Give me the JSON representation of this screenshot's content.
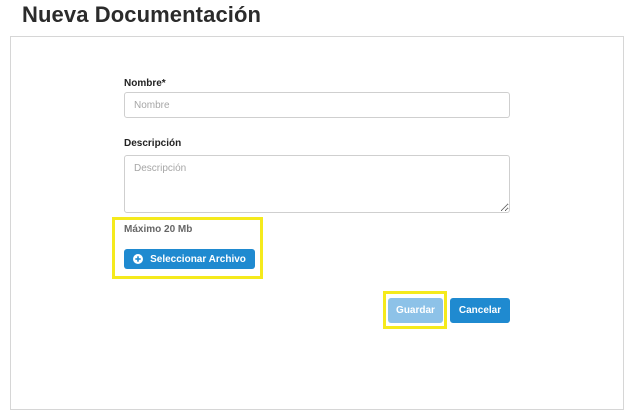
{
  "page": {
    "title": "Nueva Documentación"
  },
  "form": {
    "name_label": "Nombre*",
    "name_placeholder": "Nombre",
    "name_value": "",
    "description_label": "Descripción",
    "description_placeholder": "Descripción",
    "description_value": "",
    "max_size_text": "Máximo 20 Mb",
    "select_file_label": "Seleccionar Archivo",
    "select_file_icon": "plus-circle-icon",
    "save_label": "Guardar",
    "save_state": "disabled",
    "cancel_label": "Cancelar"
  },
  "colors": {
    "primary": "#1f8ad0",
    "primary_disabled": "#8dc2e8",
    "highlight": "#f5ea1c"
  }
}
